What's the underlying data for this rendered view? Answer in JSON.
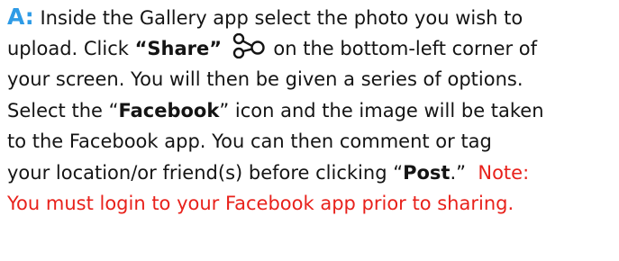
{
  "step": {
    "marker": "A:",
    "line1_text": " Inside the Gallery app select the photo you wish to",
    "line2_pre": "upload. Click ",
    "line2_bold": "“Share”",
    "line2_post": "on the bottom-left corner of",
    "line3_text": "your screen.  You will then be given a series of options.",
    "line4_pre": "Select the “",
    "line4_bold": "Facebook",
    "line4_post": "” icon and the image will be taken",
    "line5_text": "to the Facebook app.  You can then comment or tag",
    "line6_pre": "your location/or friend(s) before clicking “",
    "line6_bold": "Post",
    "line6_post": ".”  ",
    "note_line6": "Note:",
    "note_line7": "You must login to your Facebook app prior to sharing."
  },
  "icons": {
    "share": "share-icon"
  },
  "colors": {
    "marker": "#2e9be6",
    "note": "#e8211b",
    "text": "#141414"
  }
}
